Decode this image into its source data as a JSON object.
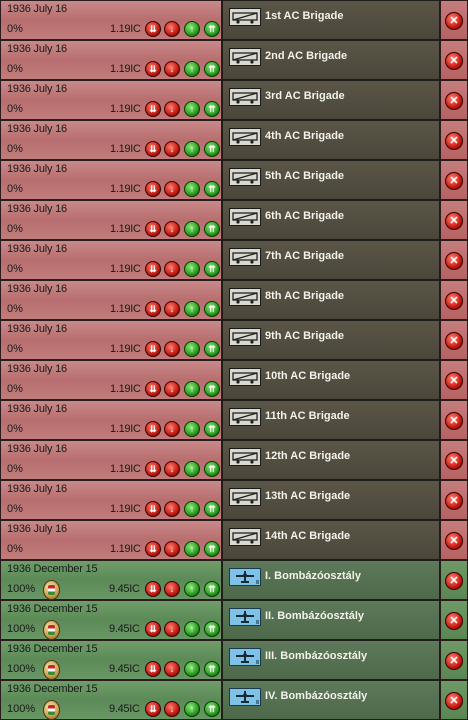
{
  "colors": {
    "ac_row": "#c07c7c",
    "bomb_row": "#5c8a57",
    "unit_panel": "#4a463a",
    "button_red": "#c01a10",
    "button_green": "#2a9a20"
  },
  "queue": [
    {
      "type": "ac",
      "date": "1936 July 16",
      "progress": "0%",
      "cost": "1.19IC",
      "name": "1st AC Brigade",
      "icon": "armored-car-icon"
    },
    {
      "type": "ac",
      "date": "1936 July 16",
      "progress": "0%",
      "cost": "1.19IC",
      "name": "2nd AC Brigade",
      "icon": "armored-car-icon"
    },
    {
      "type": "ac",
      "date": "1936 July 16",
      "progress": "0%",
      "cost": "1.19IC",
      "name": "3rd AC Brigade",
      "icon": "armored-car-icon"
    },
    {
      "type": "ac",
      "date": "1936 July 16",
      "progress": "0%",
      "cost": "1.19IC",
      "name": "4th AC Brigade",
      "icon": "armored-car-icon"
    },
    {
      "type": "ac",
      "date": "1936 July 16",
      "progress": "0%",
      "cost": "1.19IC",
      "name": "5th AC Brigade",
      "icon": "armored-car-icon"
    },
    {
      "type": "ac",
      "date": "1936 July 16",
      "progress": "0%",
      "cost": "1.19IC",
      "name": "6th AC Brigade",
      "icon": "armored-car-icon"
    },
    {
      "type": "ac",
      "date": "1936 July 16",
      "progress": "0%",
      "cost": "1.19IC",
      "name": "7th AC Brigade",
      "icon": "armored-car-icon"
    },
    {
      "type": "ac",
      "date": "1936 July 16",
      "progress": "0%",
      "cost": "1.19IC",
      "name": "8th AC Brigade",
      "icon": "armored-car-icon"
    },
    {
      "type": "ac",
      "date": "1936 July 16",
      "progress": "0%",
      "cost": "1.19IC",
      "name": "9th AC Brigade",
      "icon": "armored-car-icon"
    },
    {
      "type": "ac",
      "date": "1936 July 16",
      "progress": "0%",
      "cost": "1.19IC",
      "name": "10th AC Brigade",
      "icon": "armored-car-icon"
    },
    {
      "type": "ac",
      "date": "1936 July 16",
      "progress": "0%",
      "cost": "1.19IC",
      "name": "11th AC Brigade",
      "icon": "armored-car-icon"
    },
    {
      "type": "ac",
      "date": "1936 July 16",
      "progress": "0%",
      "cost": "1.19IC",
      "name": "12th AC Brigade",
      "icon": "armored-car-icon"
    },
    {
      "type": "ac",
      "date": "1936 July 16",
      "progress": "0%",
      "cost": "1.19IC",
      "name": "13th AC Brigade",
      "icon": "armored-car-icon"
    },
    {
      "type": "ac",
      "date": "1936 July 16",
      "progress": "0%",
      "cost": "1.19IC",
      "name": "14th AC Brigade",
      "icon": "armored-car-icon"
    },
    {
      "type": "bomb",
      "date": "1936 December 15",
      "progress": "100%",
      "cost": "9.45IC",
      "name": "I. Bombázóosztály",
      "icon": "bomber-plane-icon"
    },
    {
      "type": "bomb",
      "date": "1936 December 15",
      "progress": "100%",
      "cost": "9.45IC",
      "name": "II. Bombázóosztály",
      "icon": "bomber-plane-icon"
    },
    {
      "type": "bomb",
      "date": "1936 December 15",
      "progress": "100%",
      "cost": "9.45IC",
      "name": "III. Bombázóosztály",
      "icon": "bomber-plane-icon"
    },
    {
      "type": "bomb",
      "date": "1936 December 15",
      "progress": "100%",
      "cost": "9.45IC",
      "name": "IV. Bombázóosztály",
      "icon": "bomber-plane-icon"
    }
  ]
}
